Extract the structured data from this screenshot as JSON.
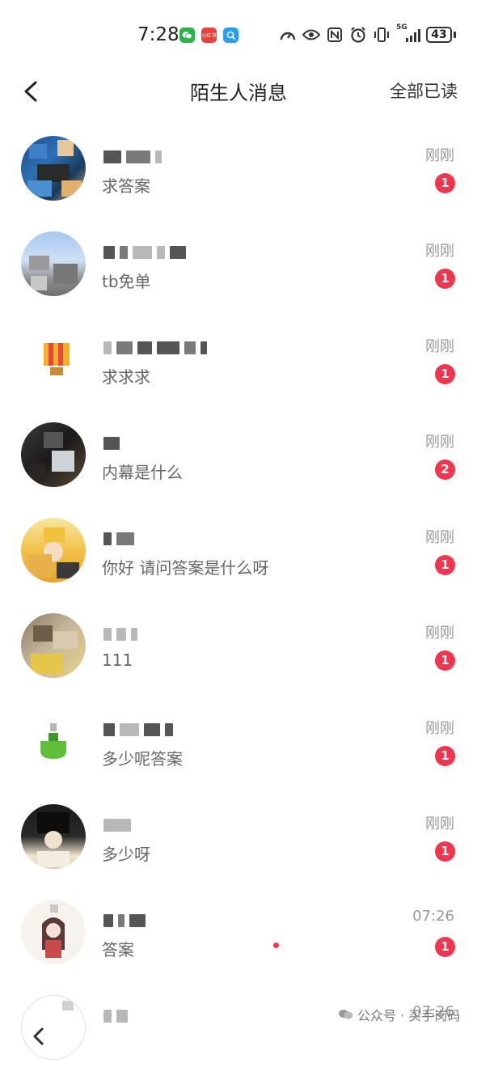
{
  "status_bar": {
    "time": "7:28",
    "battery": "43",
    "app_badges": [
      {
        "icon": "wechat-icon",
        "color": "#2bb24c",
        "label": ""
      },
      {
        "icon": "news-app-icon",
        "color": "#e8413b",
        "label": "小红书"
      },
      {
        "icon": "search-app-icon",
        "color": "#2a9df4",
        "label": ""
      }
    ],
    "system_icons": [
      "speed-gauge-icon",
      "eye-icon",
      "nfc-icon",
      "alarm-icon",
      "vibrate-icon",
      "signal-5g-icon"
    ],
    "network": "5G"
  },
  "header": {
    "title": "陌生人消息",
    "mark_all_read": "全部已读"
  },
  "colors": {
    "accent": "#f0364f",
    "muted": "#999999",
    "preview": "#666666"
  },
  "messages": [
    {
      "preview": "求答案",
      "time": "刚刚",
      "unread": "1",
      "avatar": "avatar-blue"
    },
    {
      "preview": "tb免单",
      "time": "刚刚",
      "unread": "1",
      "avatar": "avatar-sky"
    },
    {
      "preview": "求求求",
      "time": "刚刚",
      "unread": "1",
      "avatar": "avatar-balloon"
    },
    {
      "preview": "内幕是什么",
      "time": "刚刚",
      "unread": "2",
      "avatar": "avatar-dark"
    },
    {
      "preview": "你好 请问答案是什么呀",
      "time": "刚刚",
      "unread": "1",
      "avatar": "avatar-yellow"
    },
    {
      "preview": "111",
      "time": "刚刚",
      "unread": "1",
      "avatar": "avatar-brown"
    },
    {
      "preview": "多少呢答案",
      "time": "刚刚",
      "unread": "1",
      "avatar": "avatar-green"
    },
    {
      "preview": "多少呀",
      "time": "刚刚",
      "unread": "1",
      "avatar": "avatar-black"
    },
    {
      "preview": "答案",
      "time": "07:26",
      "unread": "1",
      "avatar": "avatar-anime"
    },
    {
      "preview": "",
      "time": "07:26",
      "unread": "",
      "avatar": "avatar-partial"
    }
  ],
  "watermark": "公众号 · 买手岗码"
}
